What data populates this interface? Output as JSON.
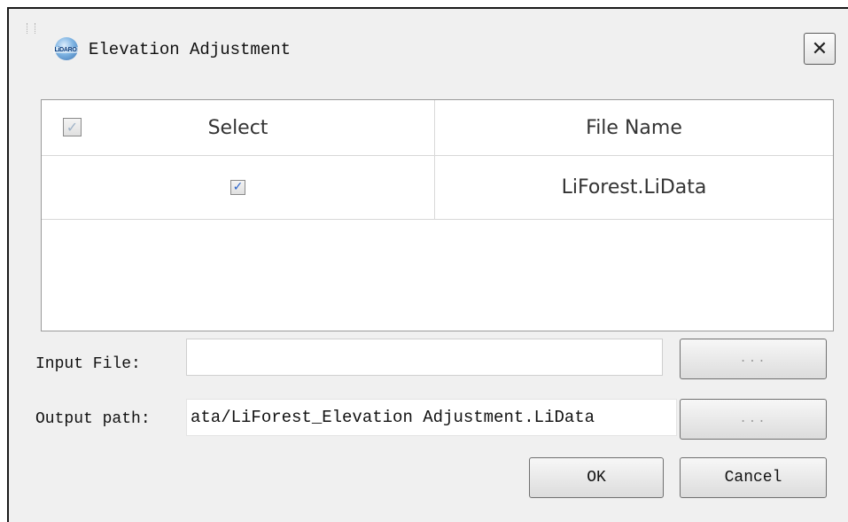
{
  "window": {
    "title": "Elevation Adjustment",
    "logo_text": "LiDARO",
    "close_label": "✕"
  },
  "table": {
    "headers": {
      "select": "Select",
      "file_name": "File Name"
    },
    "header_checked": true,
    "rows": [
      {
        "checked": true,
        "file_name": "LiForest.LiData"
      }
    ]
  },
  "form": {
    "input_label": "Input File:",
    "input_value": "",
    "output_label": "Output path:",
    "output_value": "ata/LiForest_Elevation Adjustment.LiData",
    "browse_label": "...",
    "ok_label": "OK",
    "cancel_label": "Cancel"
  }
}
